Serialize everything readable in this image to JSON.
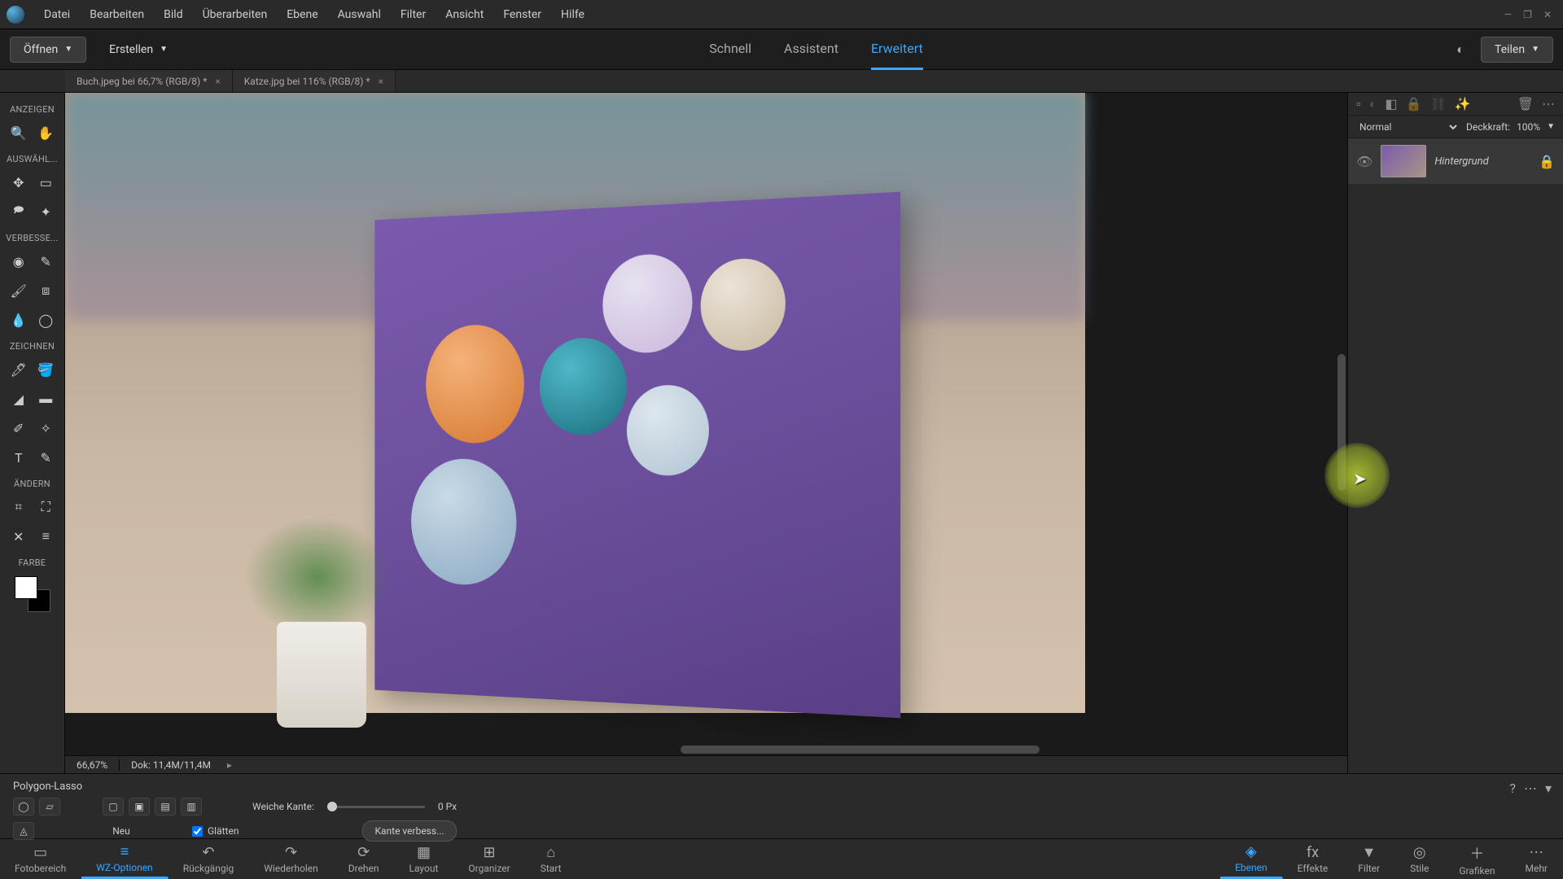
{
  "menubar": [
    "Datei",
    "Bearbeiten",
    "Bild",
    "Überarbeiten",
    "Ebene",
    "Auswahl",
    "Filter",
    "Ansicht",
    "Fenster",
    "Hilfe"
  ],
  "toolbar_top": {
    "open": "Öffnen",
    "create": "Erstellen",
    "share": "Teilen"
  },
  "mode_tabs": {
    "quick": "Schnell",
    "guided": "Assistent",
    "expert": "Erweitert"
  },
  "file_tabs": [
    {
      "label": "Buch.jpeg bei 66,7% (RGB/8) *"
    },
    {
      "label": "Katze.jpg bei 116% (RGB/8) *"
    }
  ],
  "toolbox_sections": {
    "view": "ANZEIGEN",
    "select": "AUSWÄHL...",
    "enhance": "VERBESSE...",
    "draw": "ZEICHNEN",
    "modify": "ÄNDERN",
    "color": "FARBE"
  },
  "canvas_status": {
    "zoom": "66,67%",
    "doc": "Dok: 11,4M/11,4M"
  },
  "layers_panel": {
    "blend_mode": "Normal",
    "opacity_label": "Deckkraft:",
    "opacity_value": "100%",
    "layer_name": "Hintergrund"
  },
  "tool_options": {
    "tool_name": "Polygon-Lasso",
    "mode_label": "Neu",
    "feather_label": "Weiche Kante:",
    "feather_value": "0 Px",
    "antialias": "Glätten",
    "refine_edge": "Kante verbess..."
  },
  "bottom_bar": {
    "left": [
      "Fotobereich",
      "WZ-Optionen",
      "Rückgängig",
      "Wiederholen",
      "Drehen",
      "Layout",
      "Organizer",
      "Start"
    ],
    "right": [
      "Ebenen",
      "Effekte",
      "Filter",
      "Stile",
      "Grafiken",
      "Mehr"
    ]
  }
}
